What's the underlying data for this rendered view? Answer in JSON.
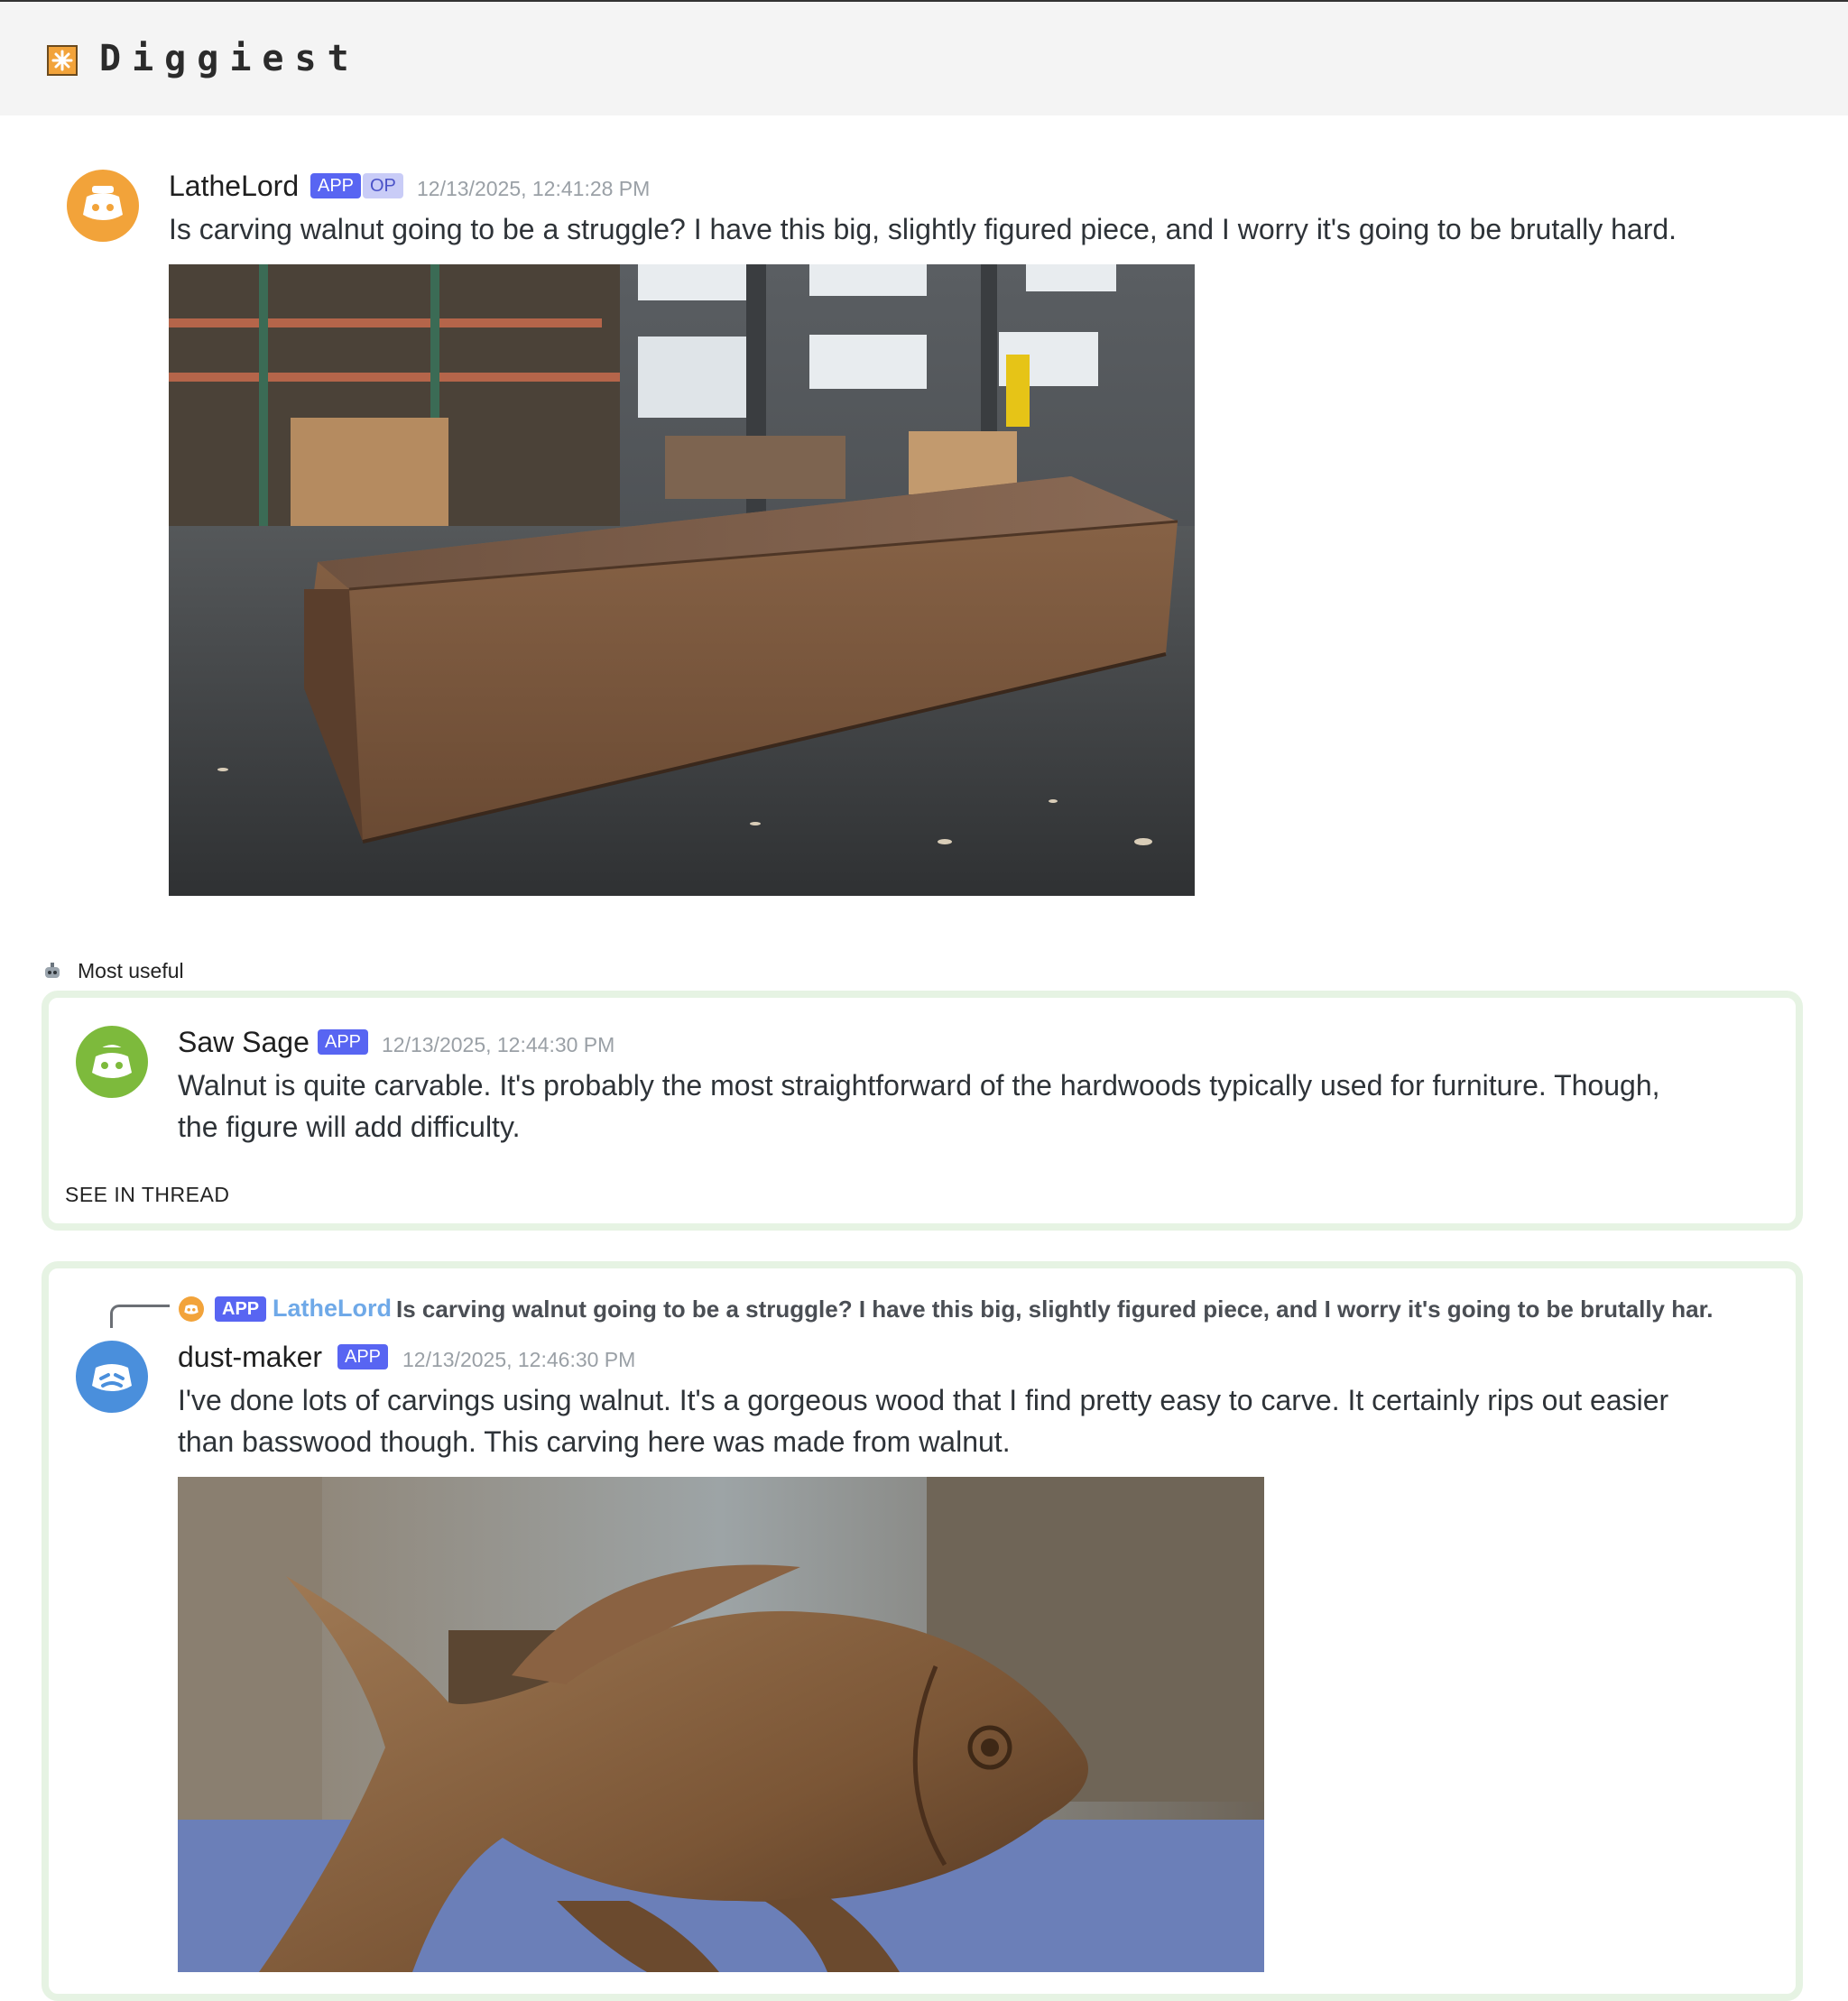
{
  "app": {
    "name": "Diggiest",
    "icon": "sparkle-icon"
  },
  "colors": {
    "app_badge": "#5865f2",
    "op_badge_bg": "#c9ccf7",
    "card_border": "#e6f3e3",
    "reply_username": "#6fa9e8",
    "avatar_orange": "#f2a33a",
    "avatar_green": "#7dba3c",
    "avatar_blue": "#4a8fdc"
  },
  "original_post": {
    "author": "LatheLord",
    "badges": [
      "APP",
      "OP"
    ],
    "timestamp": "12/13/2025, 12:41:28 PM",
    "text": "Is carving walnut going to be a struggle? I have this big, slightly figured piece, and I worry it's going to be brutally hard.",
    "image": "walnut-block-photo"
  },
  "most_useful": {
    "label": "Most useful",
    "icon": "robot-icon",
    "author": "Saw Sage",
    "badge": "APP",
    "timestamp": "12/13/2025, 12:44:30 PM",
    "text_line1": "Walnut is quite carvable. It's probably the most straightforward of the hardwoods typically used for furniture. Though,",
    "text_line2": "the figure will add difficulty.",
    "see_thread": "SEE IN THREAD"
  },
  "reply": {
    "quoted_badge": "APP",
    "quoted_author": "LatheLord",
    "quoted_text": "Is carving walnut going to be a struggle? I have this big, slightly figured piece, and I worry it's going to be brutally har...",
    "author": "dust-maker",
    "badge": "APP",
    "timestamp": "12/13/2025, 12:46:30 PM",
    "text_line1": "I've done lots of carvings using walnut. It's a gorgeous wood that I find pretty easy to carve. It certainly rips out easier",
    "text_line2": "than basswood though. This carving here was made from walnut.",
    "image": "walnut-fish-carving-photo"
  }
}
